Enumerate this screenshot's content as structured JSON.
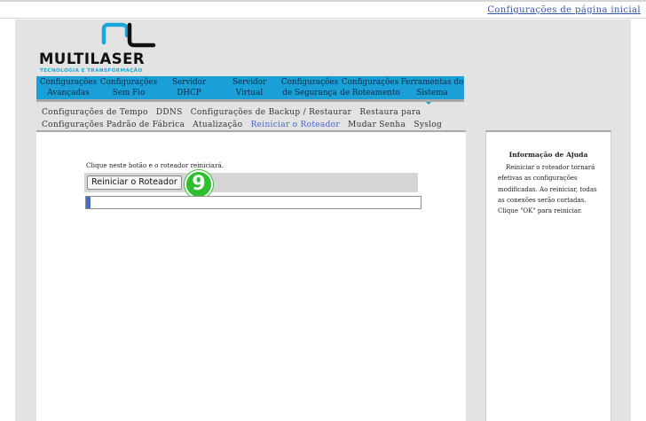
{
  "top_link": "Configurações de página inicial",
  "logo": {
    "word": "MULTILASER",
    "tagline": "TECNOLOGIA E TRANSFORMAÇÃO"
  },
  "main_nav": [
    {
      "l1": "Configurações",
      "l2": "Avançadas"
    },
    {
      "l1": "Configurações",
      "l2": "Sem Fio"
    },
    {
      "l1": "Servidor",
      "l2": "DHCP"
    },
    {
      "l1": "Servidor",
      "l2": "Virtual"
    },
    {
      "l1": "Configurações",
      "l2": "de Segurança"
    },
    {
      "l1": "Configurações",
      "l2": "de Roteamento"
    },
    {
      "l1": "Ferramentas do",
      "l2": "Sistema"
    }
  ],
  "sub_nav": [
    "Configurações de Tempo",
    "DDNS",
    "Configurações de Backup / Restaurar",
    "Restaura para Configurações Padrão de Fábrica",
    "Atualização",
    "Reiniciar o Roteador",
    "Mudar Senha",
    "Syslog"
  ],
  "content": {
    "instruction": "Clique neste botão e o roteador reiniciará.",
    "reboot_button": "Reiniciar o Roteador",
    "step_badge": "9",
    "progress_fraction": 0.012
  },
  "help": {
    "title": "Informação de Ajuda",
    "text": "Reiniciar o roteador tornará efetivas as configurações modificadas. Ao reiniciar, todas as conexões serão cortadas. Clique \"OK\" para reiniciar."
  },
  "colors": {
    "nav_blue": "#1a9fd7",
    "link_blue": "#3355aa",
    "badge_green": "#2fbe2f",
    "progress_fill": "#3a6fd0"
  }
}
